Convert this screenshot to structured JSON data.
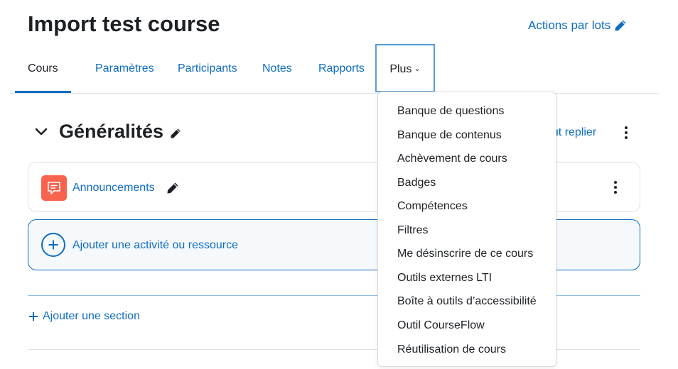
{
  "header": {
    "course_title": "Import test course",
    "bulk_actions_label": "Actions par lots"
  },
  "tabs": [
    {
      "label": "Cours",
      "active": true
    },
    {
      "label": "Paramètres",
      "active": false
    },
    {
      "label": "Participants",
      "active": false
    },
    {
      "label": "Notes",
      "active": false
    },
    {
      "label": "Rapports",
      "active": false
    }
  ],
  "more_tab": {
    "label": "Plus",
    "expanded": true
  },
  "more_menu": {
    "items": [
      "Banque de questions",
      "Banque de contenus",
      "Achèvement de cours",
      "Badges",
      "Compétences",
      "Filtres",
      "Me désinscrire de ce cours",
      "Outils externes LTI",
      "Boîte à outils d’accessibilité",
      "Outil CourseFlow",
      "Réutilisation de cours"
    ]
  },
  "section": {
    "title": "Généralités",
    "collapse_all_label": "Tout replier",
    "icons": [
      "chevron-down-icon",
      "pencil-icon",
      "kebab-icon"
    ]
  },
  "activity": {
    "name": "Announcements",
    "icon": "forum-icon",
    "icon_color": "#f7634d"
  },
  "add_activity": {
    "label": "Ajouter une activité ou ressource"
  },
  "add_section": {
    "label": "Ajouter une section"
  },
  "colors": {
    "link": "#0f6cbf",
    "text": "#1d2125",
    "focus_border": "#5b9bd5"
  }
}
